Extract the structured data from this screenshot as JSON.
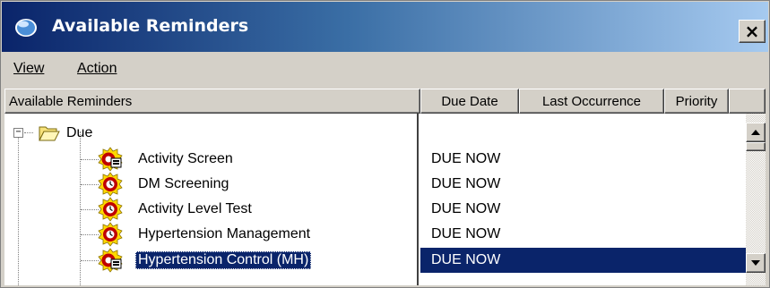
{
  "window": {
    "title": "Available Reminders",
    "close_label": "×"
  },
  "menu": {
    "items": [
      {
        "label": "View"
      },
      {
        "label": "Action"
      }
    ]
  },
  "columns": [
    {
      "label": "Available Reminders"
    },
    {
      "label": "Due Date"
    },
    {
      "label": "Last Occurrence"
    },
    {
      "label": "Priority"
    }
  ],
  "tree": {
    "group": {
      "label": "Due",
      "expanded": true,
      "expander": "−"
    },
    "items": [
      {
        "label": "Activity Screen",
        "due_date": "DUE NOW",
        "icon": "reminder-clinic-icon",
        "selected": false
      },
      {
        "label": "DM Screening",
        "due_date": "DUE NOW",
        "icon": "reminder-alarm-icon",
        "selected": false
      },
      {
        "label": "Activity Level Test",
        "due_date": "DUE NOW",
        "icon": "reminder-alarm-icon",
        "selected": false
      },
      {
        "label": "Hypertension Management",
        "due_date": "DUE NOW",
        "icon": "reminder-alarm-icon",
        "selected": false
      },
      {
        "label": "Hypertension Control (MH)",
        "due_date": "DUE NOW",
        "icon": "reminder-clinic-icon",
        "selected": true
      }
    ]
  },
  "colors": {
    "title_gradient_start": "#0a246a",
    "title_gradient_end": "#a6caf0",
    "selection": "#0a246a",
    "face": "#d4d0c8"
  }
}
